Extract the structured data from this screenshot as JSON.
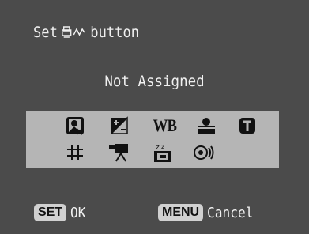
{
  "header": {
    "title_prefix": "Set",
    "title_suffix": "button",
    "title_icon": "print-share-icon"
  },
  "status_text": "Not Assigned",
  "function_icons": [
    {
      "row": 1,
      "name": "exposure-compensation-icon"
    },
    {
      "row": 1,
      "name": "plus-minus-icon"
    },
    {
      "row": 1,
      "name": "white-balance-icon",
      "label": "WB"
    },
    {
      "row": 1,
      "name": "face-detect-icon"
    },
    {
      "row": 1,
      "name": "t-mode-icon"
    },
    {
      "row": 2,
      "name": "grid-icon"
    },
    {
      "row": 2,
      "name": "movie-icon"
    },
    {
      "row": 2,
      "name": "sleep-display-icon"
    },
    {
      "row": 2,
      "name": "sound-icon"
    }
  ],
  "footer": {
    "ok_key": "SET",
    "ok_label": "OK",
    "cancel_key": "MENU",
    "cancel_label": "Cancel"
  },
  "colors": {
    "background": "#4b4b4b",
    "panel": "#b5b5b5",
    "icon": "#111111",
    "text": "#f0f0f0"
  }
}
